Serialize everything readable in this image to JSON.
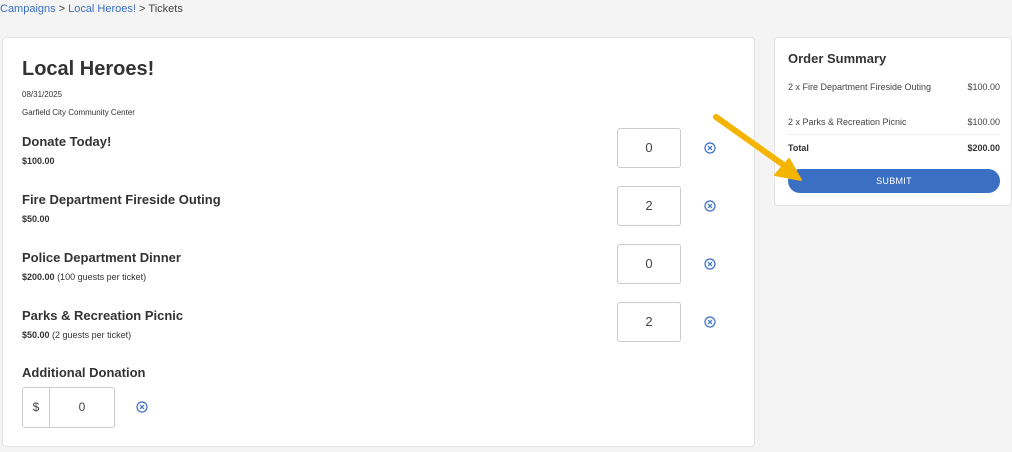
{
  "breadcrumb": {
    "items": [
      "Campaigns",
      "Local Heroes!",
      "Tickets"
    ],
    "separator": ">"
  },
  "event": {
    "title": "Local Heroes!",
    "date": "08/31/2025",
    "venue": "Garfield City Community Center"
  },
  "tickets": [
    {
      "name": "Donate Today!",
      "price": "$100.00",
      "note": "",
      "quantity": "0"
    },
    {
      "name": "Fire Department Fireside Outing",
      "price": "$50.00",
      "note": "",
      "quantity": "2"
    },
    {
      "name": "Police Department Dinner",
      "price": "$200.00",
      "note": "(100 guests per ticket)",
      "quantity": "0"
    },
    {
      "name": "Parks & Recreation Picnic",
      "price": "$50.00",
      "note": "(2 guests per ticket)",
      "quantity": "2"
    }
  ],
  "additional_donation": {
    "label": "Additional Donation",
    "prefix": "$",
    "value": "0"
  },
  "order_summary": {
    "title": "Order Summary",
    "lines": [
      {
        "label": "2 x Fire Department Fireside Outing",
        "amount": "$100.00"
      },
      {
        "label": "2 x Parks & Recreation Picnic",
        "amount": "$100.00"
      }
    ],
    "total_label": "Total",
    "total_amount": "$200.00",
    "submit_label": "SUBMIT"
  },
  "colors": {
    "accent": "#3a6fc4",
    "annotation_arrow": "#f5b400"
  }
}
